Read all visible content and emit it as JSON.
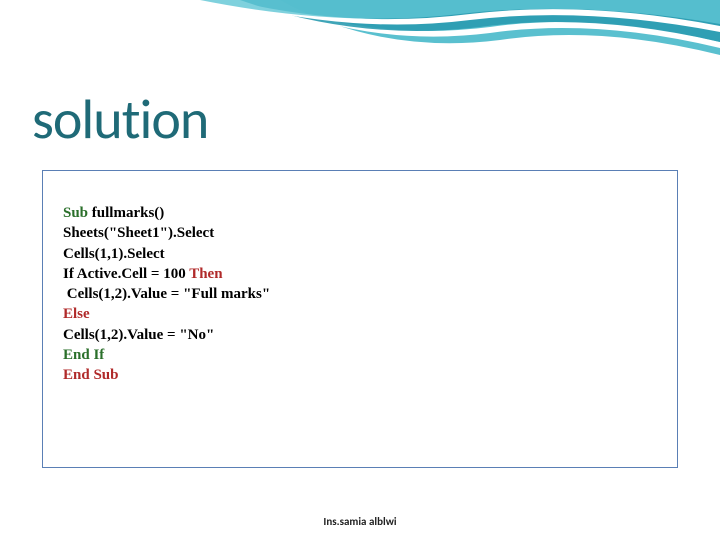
{
  "slide": {
    "title": "solution",
    "footer": "Ins.samia alblwi"
  },
  "code": {
    "lines": [
      {
        "segments": [
          {
            "t": "Sub ",
            "cls": "kw-sub"
          },
          {
            "t": "fullmarks()",
            "cls": ""
          }
        ]
      },
      {
        "segments": [
          {
            "t": "Sheets(\"Sheet1\").Select",
            "cls": ""
          }
        ]
      },
      {
        "segments": [
          {
            "t": "Cells(1,1).Select",
            "cls": ""
          }
        ]
      },
      {
        "segments": [
          {
            "t": "If ",
            "cls": ""
          },
          {
            "t": "Active.Cell = 100 ",
            "cls": ""
          },
          {
            "t": "Then",
            "cls": "kw-then"
          }
        ]
      },
      {
        "segments": [
          {
            "t": " Cells(1,2).Value = \"Full marks\"",
            "cls": ""
          }
        ]
      },
      {
        "segments": [
          {
            "t": "Else",
            "cls": "kw-else"
          }
        ]
      },
      {
        "segments": [
          {
            "t": "Cells(1,2).Value = \"No\"",
            "cls": ""
          }
        ]
      },
      {
        "segments": [
          {
            "t": "End If",
            "cls": "kw-endif"
          }
        ]
      },
      {
        "segments": [
          {
            "t": "End Sub",
            "cls": "kw-endsub"
          }
        ]
      }
    ]
  }
}
